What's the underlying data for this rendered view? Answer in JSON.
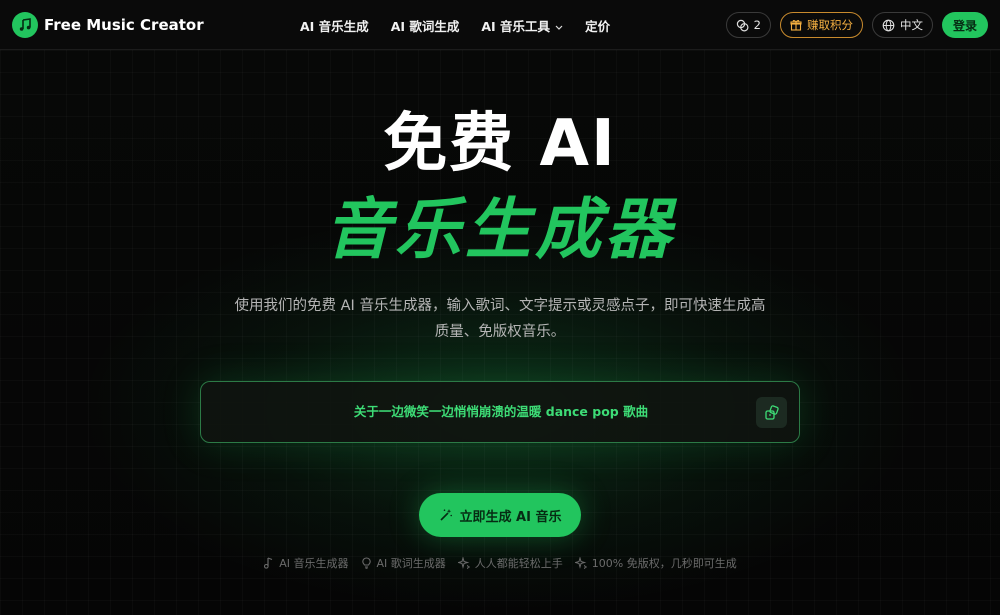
{
  "header": {
    "logo_text": "Free Music Creator",
    "nav": [
      {
        "label": "AI 音乐生成"
      },
      {
        "label": "AI 歌词生成"
      },
      {
        "label": "AI 音乐工具",
        "has_dropdown": true
      },
      {
        "label": "定价"
      }
    ],
    "credits_count": "2",
    "earn_label": "赚取积分",
    "language_label": "中文",
    "login_label": "登录"
  },
  "hero": {
    "title_line1": "免费 AI",
    "title_line2": "音乐生成器",
    "description": "使用我们的免费 AI 音乐生成器，输入歌词、文字提示或灵感点子，即可快速生成高质量、免版权音乐。"
  },
  "prompt": {
    "text": "关于一边微笑一边悄悄崩溃的温暖 dance pop 歌曲"
  },
  "cta": {
    "label": "立即生成 AI 音乐"
  },
  "features": [
    {
      "icon": "music-note-icon",
      "label": "AI 音乐生成器"
    },
    {
      "icon": "lightbulb-icon",
      "label": "AI 歌词生成器"
    },
    {
      "icon": "sparkles-icon",
      "label": "人人都能轻松上手"
    },
    {
      "icon": "sparkles-icon",
      "label": "100% 免版权，几秒即可生成"
    }
  ],
  "colors": {
    "accent": "#22c55e",
    "earn_accent": "#f5b041",
    "background": "#050505"
  }
}
